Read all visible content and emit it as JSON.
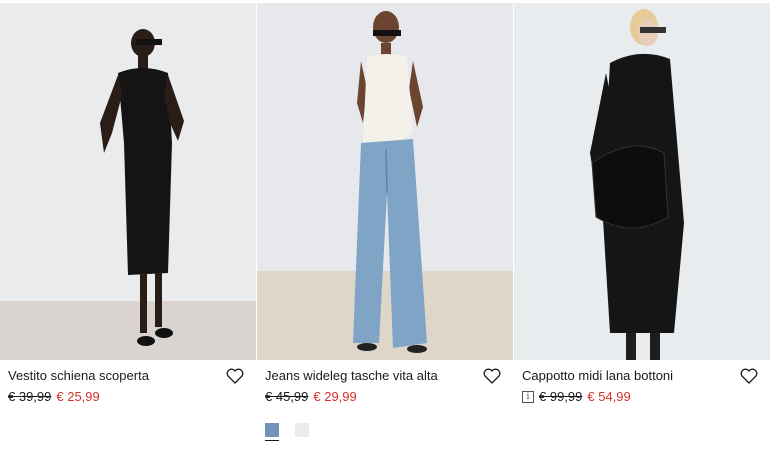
{
  "products": [
    {
      "name": "Vestito schiena scoperta",
      "old_price": "€ 39,99",
      "new_price": "€ 25,99"
    },
    {
      "name": "Jeans wideleg tasche vita alta",
      "old_price": "€ 45,99",
      "new_price": "€ 29,99",
      "swatches": [
        {
          "color": "#6f93b8",
          "selected": true
        },
        {
          "color": "#ececec",
          "selected": false
        }
      ]
    },
    {
      "name": "Cappotto midi lana bottoni",
      "info_icon": "i",
      "old_price": "€ 99,99",
      "new_price": "€ 54,99"
    }
  ],
  "colors": {
    "sale_price": "#d6312a",
    "text": "#1a1a1a"
  }
}
